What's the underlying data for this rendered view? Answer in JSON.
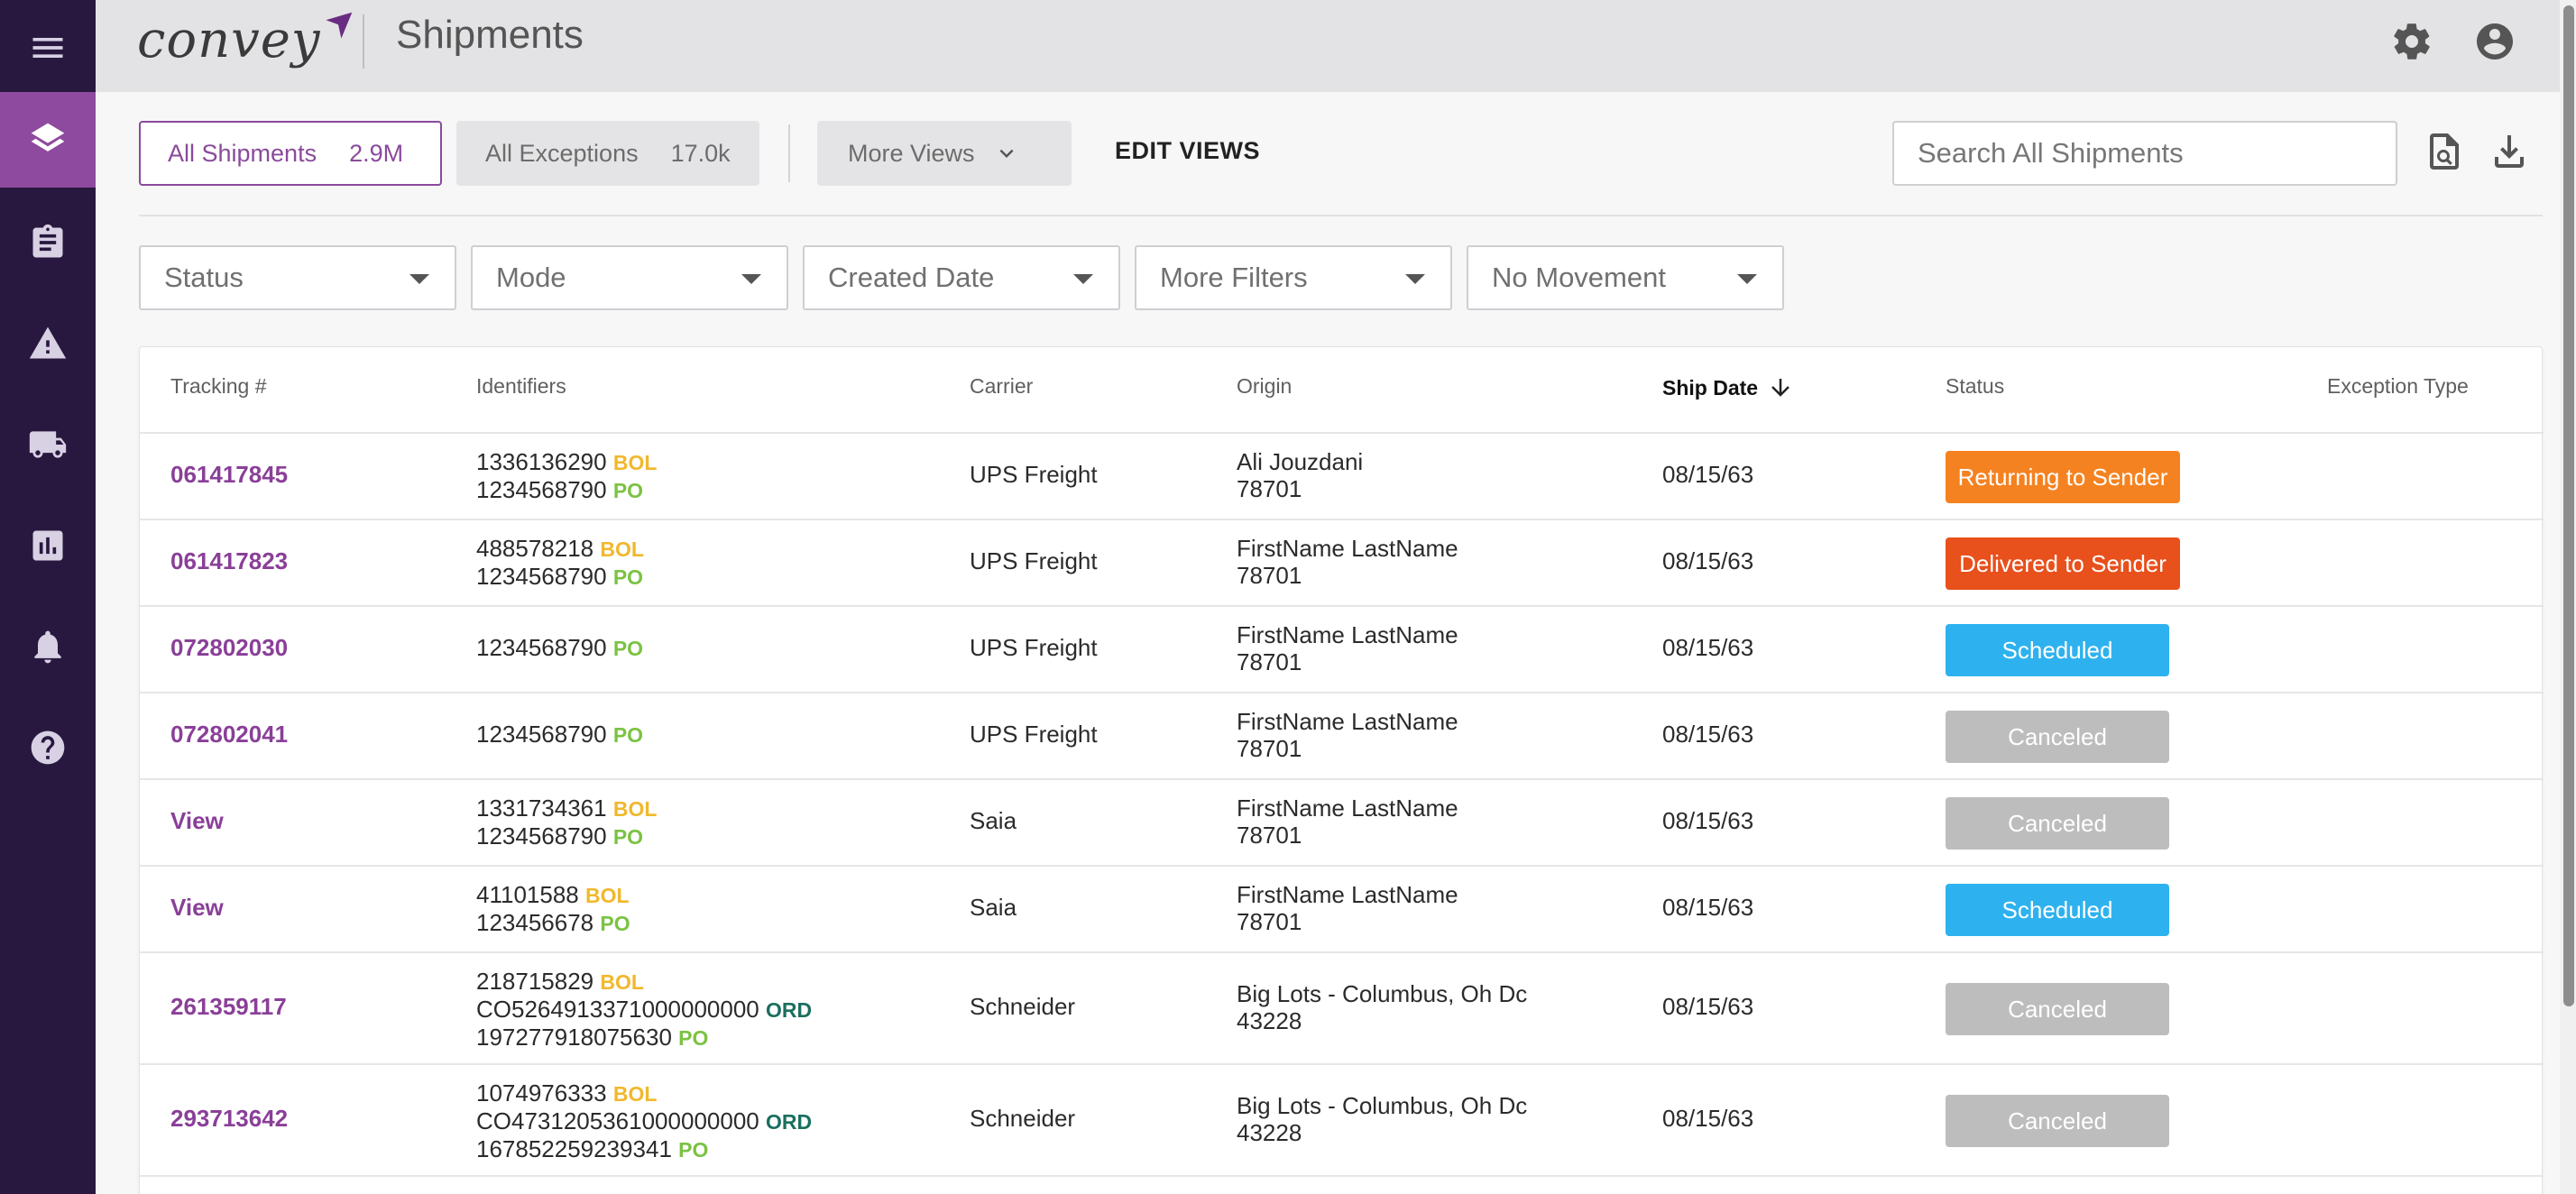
{
  "app": {
    "title": "Shipments",
    "logo_text": "convey"
  },
  "sidebar": {
    "items": [
      {
        "name": "menu",
        "icon": "hamburger-icon"
      },
      {
        "name": "shipments",
        "icon": "layers-icon",
        "active": true
      },
      {
        "name": "clipboard",
        "icon": "clipboard-icon"
      },
      {
        "name": "exceptions",
        "icon": "warning-icon"
      },
      {
        "name": "carriers",
        "icon": "truck-icon"
      },
      {
        "name": "analytics",
        "icon": "chart-icon"
      },
      {
        "name": "notifications",
        "icon": "bell-icon"
      },
      {
        "name": "help",
        "icon": "help-icon"
      }
    ]
  },
  "views": {
    "all_shipments": {
      "label": "All Shipments",
      "count": "2.9M"
    },
    "all_exceptions": {
      "label": "All Exceptions",
      "count": "17.0k"
    },
    "more_views": "More Views",
    "edit_views": "EDIT VIEWS"
  },
  "search": {
    "placeholder": "Search All Shipments"
  },
  "filters": [
    "Status",
    "Mode",
    "Created Date",
    "More Filters",
    "No Movement"
  ],
  "table": {
    "columns": {
      "tracking": "Tracking #",
      "identifiers": "Identifiers",
      "carrier": "Carrier",
      "origin": "Origin",
      "ship_date": "Ship Date",
      "status": "Status",
      "exception_type": "Exception Type"
    },
    "rows": [
      {
        "tracking": "061417845",
        "ids": [
          {
            "value": "1336136290",
            "tag": "BOL"
          },
          {
            "value": "1234568790",
            "tag": "PO"
          }
        ],
        "carrier": "UPS Freight",
        "origin_name": "Ali Jouzdani",
        "origin_zip": "78701",
        "ship_date": "08/15/63",
        "status": "Returning to Sender",
        "status_color": "#f58220"
      },
      {
        "tracking": "061417823",
        "ids": [
          {
            "value": "488578218",
            "tag": "BOL"
          },
          {
            "value": "1234568790",
            "tag": "PO"
          }
        ],
        "carrier": "UPS Freight",
        "origin_name": "FirstName LastName",
        "origin_zip": "78701",
        "ship_date": "08/15/63",
        "status": "Delivered to Sender",
        "status_color": "#e8501c"
      },
      {
        "tracking": "072802030",
        "ids": [
          {
            "value": "1234568790",
            "tag": "PO"
          }
        ],
        "carrier": "UPS Freight",
        "origin_name": "FirstName LastName",
        "origin_zip": "78701",
        "ship_date": "08/15/63",
        "status": "Scheduled",
        "status_color": "#2eb2ef"
      },
      {
        "tracking": "072802041",
        "ids": [
          {
            "value": "1234568790",
            "tag": "PO"
          }
        ],
        "carrier": "UPS Freight",
        "origin_name": "FirstName LastName",
        "origin_zip": "78701",
        "ship_date": "08/15/63",
        "status": "Canceled",
        "status_color": "#bdbdbd"
      },
      {
        "tracking": "View",
        "ids": [
          {
            "value": "1331734361",
            "tag": "BOL"
          },
          {
            "value": "1234568790",
            "tag": "PO"
          }
        ],
        "carrier": "Saia",
        "origin_name": "FirstName LastName",
        "origin_zip": "78701",
        "ship_date": "08/15/63",
        "status": "Canceled",
        "status_color": "#bdbdbd"
      },
      {
        "tracking": "View",
        "ids": [
          {
            "value": "41101588",
            "tag": "BOL"
          },
          {
            "value": "123456678",
            "tag": "PO"
          }
        ],
        "carrier": "Saia",
        "origin_name": "FirstName LastName",
        "origin_zip": "78701",
        "ship_date": "08/15/63",
        "status": "Scheduled",
        "status_color": "#2eb2ef"
      },
      {
        "tracking": "261359117",
        "ids": [
          {
            "value": "218715829",
            "tag": "BOL"
          },
          {
            "value": "CO5264913371000000000",
            "tag": "ORD"
          },
          {
            "value": "197277918075630",
            "tag": "PO"
          }
        ],
        "carrier": "Schneider",
        "origin_name": "Big Lots - Columbus, Oh Dc",
        "origin_zip": "43228",
        "ship_date": "08/15/63",
        "status": "Canceled",
        "status_color": "#bdbdbd"
      },
      {
        "tracking": "293713642",
        "ids": [
          {
            "value": "1074976333",
            "tag": "BOL"
          },
          {
            "value": "CO4731205361000000000",
            "tag": "ORD"
          },
          {
            "value": "167852259239341",
            "tag": "PO"
          }
        ],
        "carrier": "Schneider",
        "origin_name": "Big Lots - Columbus, Oh Dc",
        "origin_zip": "43228",
        "ship_date": "08/15/63",
        "status": "Canceled",
        "status_color": "#bdbdbd"
      }
    ]
  },
  "colors": {
    "brand": "#8a3f98",
    "sidebar": "#28183f",
    "sidebar_active": "#8d4a9e"
  }
}
